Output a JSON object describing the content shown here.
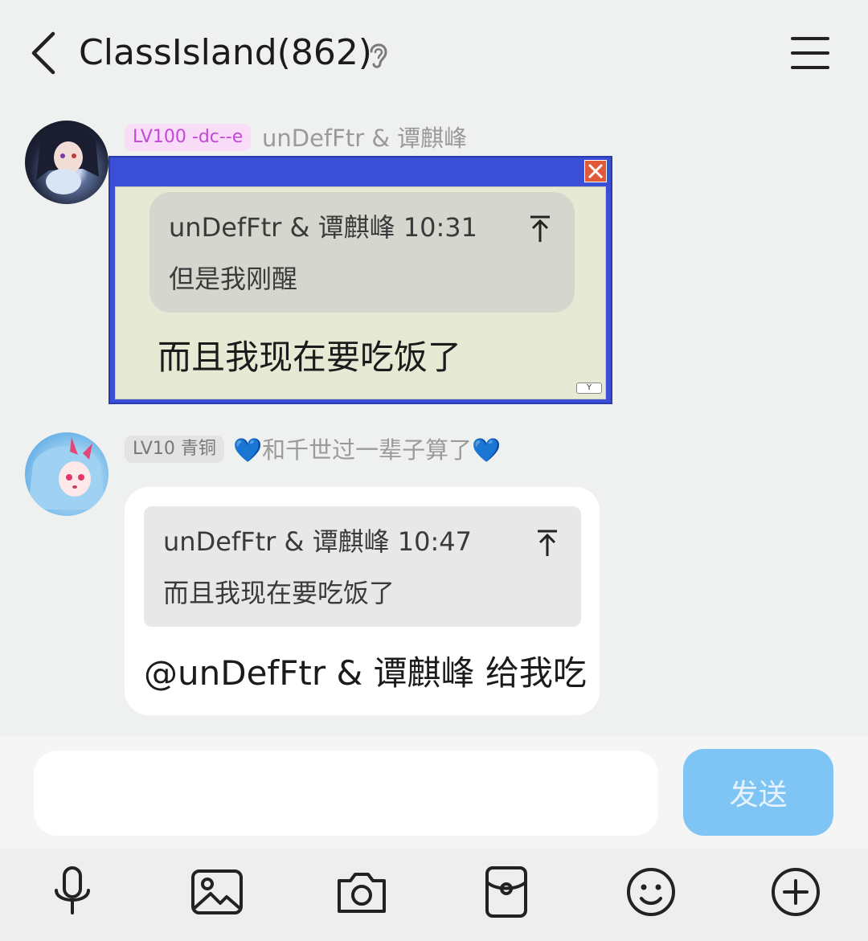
{
  "header": {
    "title": "ClassIsland(862)",
    "icons": {
      "back": "chevron-left-icon",
      "ear": "ear-icon",
      "menu": "menu-icon"
    }
  },
  "messages": [
    {
      "sender": "unDefFtr & 谭麒峰",
      "badge": "LV100 -dc--e",
      "badge_color": "#c448d8",
      "quote": {
        "header": "unDefFtr & 谭麒峰 10:31",
        "text": "但是我刚醒"
      },
      "text": "而且我现在要吃饭了",
      "window_button": "Y"
    },
    {
      "sender": "💙和千世过一辈子算了💙",
      "badge": "LV10 青铜",
      "badge_color": "#777777",
      "quote": {
        "header": "unDefFtr & 谭麒峰 10:47",
        "text": "而且我现在要吃饭了"
      },
      "text": "@unDefFtr & 谭麒峰 给我吃"
    }
  ],
  "input": {
    "placeholder": "",
    "send_label": "发送",
    "send_color": "#7ec5f5"
  },
  "toolbar": {
    "items": [
      "microphone-icon",
      "image-icon",
      "camera-icon",
      "red-packet-icon",
      "emoji-icon",
      "plus-icon"
    ]
  }
}
